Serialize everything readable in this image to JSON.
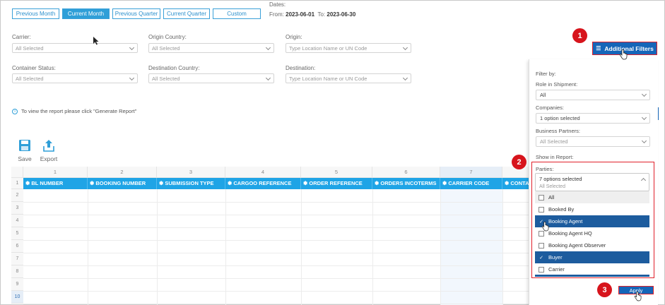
{
  "periods": [
    {
      "label": "Previous Month",
      "active": false
    },
    {
      "label": "Current Month",
      "active": true
    },
    {
      "label": "Previous Quarter",
      "active": false
    },
    {
      "label": "Current Quarter",
      "active": false
    },
    {
      "label": "Custom",
      "active": false
    }
  ],
  "dates": {
    "label": "Dates:",
    "from_label": "From:",
    "from": "2023-06-01",
    "to_label": "To:",
    "to": "2023-06-30"
  },
  "filters": {
    "carrier": {
      "label": "Carrier:",
      "value": "All Selected"
    },
    "origin_country": {
      "label": "Origin Country:",
      "value": "All Selected"
    },
    "origin": {
      "label": "Origin:",
      "placeholder": "Type Location Name or UN Code"
    },
    "container_status": {
      "label": "Container Status:",
      "value": "All Selected"
    },
    "destination_country": {
      "label": "Destination Country:",
      "value": "All Selected"
    },
    "destination": {
      "label": "Destination:",
      "placeholder": "Type Location Name or UN Code"
    }
  },
  "info_text": "To view the report please click \"Generate Report\"",
  "toolbar": {
    "save": "Save",
    "export": "Export"
  },
  "grid": {
    "col_numbers": [
      "1",
      "2",
      "3",
      "4",
      "5",
      "6",
      "7"
    ],
    "headers": [
      "BL NUMBER",
      "BOOKING NUMBER",
      "SUBMISSION TYPE",
      "CARGOO REFERENCE",
      "ORDER REFERENCE",
      "ORDERS INCOTERMS",
      "CARRIER CODE",
      "CONTAI"
    ],
    "row_numbers": [
      "1",
      "2",
      "3",
      "4",
      "5",
      "6",
      "7",
      "8",
      "9",
      "10"
    ]
  },
  "additional_filters": {
    "label": "Additional Filters"
  },
  "panel": {
    "filter_by": "Filter by:",
    "role_label": "Role in Shipment:",
    "role_value": "All",
    "companies_label": "Companies:",
    "companies_value": "1 option selected",
    "partners_label": "Business Partners:",
    "partners_value": "All Selected",
    "show_in_report": "Show in Report:",
    "parties_label": "Parties:",
    "parties_value": "7 options selected",
    "parties_sub": "All Selected",
    "options": [
      {
        "label": "All",
        "checked": false
      },
      {
        "label": "Booked By",
        "checked": false
      },
      {
        "label": "Booking Agent",
        "checked": true
      },
      {
        "label": "Booking Agent HQ",
        "checked": false
      },
      {
        "label": "Booking Agent Observer",
        "checked": false
      },
      {
        "label": "Buyer",
        "checked": true
      },
      {
        "label": "Carrier",
        "checked": false
      }
    ],
    "apply": "Apply"
  },
  "badges": [
    "1",
    "2",
    "3"
  ],
  "colors": {
    "accent": "#1fa4e6",
    "primary": "#1565b8",
    "highlight": "#e0202a",
    "selected": "#1d5c9e"
  }
}
